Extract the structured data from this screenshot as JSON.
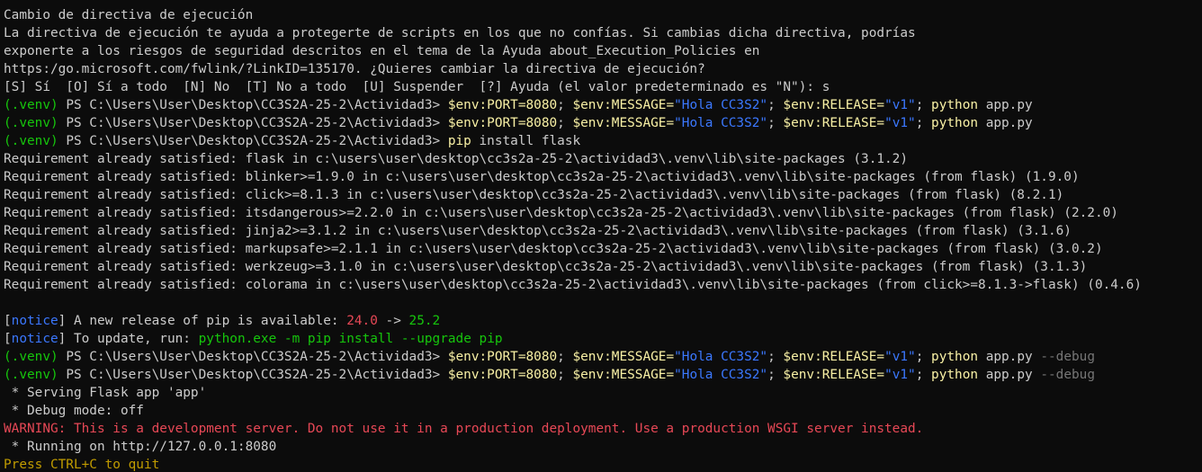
{
  "window": {
    "title": ""
  },
  "colors": {
    "default": "#cccccc",
    "venv": "#16c60c",
    "cmd": "#f9f1a5",
    "param": "#767676",
    "string": "#3b78ff",
    "notice_bracket": "#cccccc",
    "notice": "#3b78ff",
    "red": "#e74856",
    "green": "#16c60c",
    "yellow": "#c19c00"
  },
  "lines": [
    [
      {
        "t": "Cambio de directiva de ejecución",
        "c": "default"
      }
    ],
    [
      {
        "t": "La directiva de ejecución te ayuda a protegerte de scripts en los que no confías. Si cambias dicha directiva, podrías",
        "c": "default"
      }
    ],
    [
      {
        "t": "exponerte a los riesgos de seguridad descritos en el tema de la Ayuda about_Execution_Policies en",
        "c": "default"
      }
    ],
    [
      {
        "t": "https:/go.microsoft.com/fwlink/?LinkID=135170. ¿Quieres cambiar la directiva de ejecución?",
        "c": "default"
      }
    ],
    [
      {
        "t": "[S] Sí  [O] Sí a todo  [N] No  [T] No a todo  [U] Suspender  [?] Ayuda (el valor predeterminado es \"N\"): s",
        "c": "default"
      }
    ],
    [
      {
        "t": "(.venv)",
        "c": "venv"
      },
      {
        "t": " PS C:\\Users\\User\\Desktop\\CC3S2A-25-2\\Actividad3> ",
        "c": "default"
      },
      {
        "t": "$env:PORT=8080",
        "c": "cmd"
      },
      {
        "t": "; ",
        "c": "default"
      },
      {
        "t": "$env:MESSAGE=",
        "c": "cmd"
      },
      {
        "t": "\"Hola CC3S2\"",
        "c": "string"
      },
      {
        "t": "; ",
        "c": "default"
      },
      {
        "t": "$env:RELEASE=",
        "c": "cmd"
      },
      {
        "t": "\"v1\"",
        "c": "string"
      },
      {
        "t": "; ",
        "c": "default"
      },
      {
        "t": "python",
        "c": "cmd"
      },
      {
        "t": " app.py",
        "c": "default"
      }
    ],
    [
      {
        "t": "(.venv)",
        "c": "venv"
      },
      {
        "t": " PS C:\\Users\\User\\Desktop\\CC3S2A-25-2\\Actividad3> ",
        "c": "default"
      },
      {
        "t": "$env:PORT=8080",
        "c": "cmd"
      },
      {
        "t": "; ",
        "c": "default"
      },
      {
        "t": "$env:MESSAGE=",
        "c": "cmd"
      },
      {
        "t": "\"Hola CC3S2\"",
        "c": "string"
      },
      {
        "t": "; ",
        "c": "default"
      },
      {
        "t": "$env:RELEASE=",
        "c": "cmd"
      },
      {
        "t": "\"v1\"",
        "c": "string"
      },
      {
        "t": "; ",
        "c": "default"
      },
      {
        "t": "python",
        "c": "cmd"
      },
      {
        "t": " app.py",
        "c": "default"
      }
    ],
    [
      {
        "t": "(.venv)",
        "c": "venv"
      },
      {
        "t": " PS C:\\Users\\User\\Desktop\\CC3S2A-25-2\\Actividad3> ",
        "c": "default"
      },
      {
        "t": "pip",
        "c": "cmd"
      },
      {
        "t": " install flask",
        "c": "default"
      }
    ],
    [
      {
        "t": "Requirement already satisfied: flask in c:\\users\\user\\desktop\\cc3s2a-25-2\\actividad3\\.venv\\lib\\site-packages (3.1.2)",
        "c": "default"
      }
    ],
    [
      {
        "t": "Requirement already satisfied: blinker>=1.9.0 in c:\\users\\user\\desktop\\cc3s2a-25-2\\actividad3\\.venv\\lib\\site-packages (from flask) (1.9.0)",
        "c": "default"
      }
    ],
    [
      {
        "t": "Requirement already satisfied: click>=8.1.3 in c:\\users\\user\\desktop\\cc3s2a-25-2\\actividad3\\.venv\\lib\\site-packages (from flask) (8.2.1)",
        "c": "default"
      }
    ],
    [
      {
        "t": "Requirement already satisfied: itsdangerous>=2.2.0 in c:\\users\\user\\desktop\\cc3s2a-25-2\\actividad3\\.venv\\lib\\site-packages (from flask) (2.2.0)",
        "c": "default"
      }
    ],
    [
      {
        "t": "Requirement already satisfied: jinja2>=3.1.2 in c:\\users\\user\\desktop\\cc3s2a-25-2\\actividad3\\.venv\\lib\\site-packages (from flask) (3.1.6)",
        "c": "default"
      }
    ],
    [
      {
        "t": "Requirement already satisfied: markupsafe>=2.1.1 in c:\\users\\user\\desktop\\cc3s2a-25-2\\actividad3\\.venv\\lib\\site-packages (from flask) (3.0.2)",
        "c": "default"
      }
    ],
    [
      {
        "t": "Requirement already satisfied: werkzeug>=3.1.0 in c:\\users\\user\\desktop\\cc3s2a-25-2\\actividad3\\.venv\\lib\\site-packages (from flask) (3.1.3)",
        "c": "default"
      }
    ],
    [
      {
        "t": "Requirement already satisfied: colorama in c:\\users\\user\\desktop\\cc3s2a-25-2\\actividad3\\.venv\\lib\\site-packages (from click>=8.1.3->flask) (0.4.6)",
        "c": "default"
      }
    ],
    [],
    [
      {
        "t": "[",
        "c": "notice_bracket"
      },
      {
        "t": "notice",
        "c": "notice"
      },
      {
        "t": "]",
        "c": "notice_bracket"
      },
      {
        "t": " A new release of pip is available: ",
        "c": "default"
      },
      {
        "t": "24.0",
        "c": "red"
      },
      {
        "t": " -> ",
        "c": "default"
      },
      {
        "t": "25.2",
        "c": "green"
      }
    ],
    [
      {
        "t": "[",
        "c": "notice_bracket"
      },
      {
        "t": "notice",
        "c": "notice"
      },
      {
        "t": "]",
        "c": "notice_bracket"
      },
      {
        "t": " To update, run: ",
        "c": "default"
      },
      {
        "t": "python.exe -m pip install --upgrade pip",
        "c": "green"
      }
    ],
    [
      {
        "t": "(.venv)",
        "c": "venv"
      },
      {
        "t": " PS C:\\Users\\User\\Desktop\\CC3S2A-25-2\\Actividad3> ",
        "c": "default"
      },
      {
        "t": "$env:PORT=8080",
        "c": "cmd"
      },
      {
        "t": "; ",
        "c": "default"
      },
      {
        "t": "$env:MESSAGE=",
        "c": "cmd"
      },
      {
        "t": "\"Hola CC3S2\"",
        "c": "string"
      },
      {
        "t": "; ",
        "c": "default"
      },
      {
        "t": "$env:RELEASE=",
        "c": "cmd"
      },
      {
        "t": "\"v1\"",
        "c": "string"
      },
      {
        "t": "; ",
        "c": "default"
      },
      {
        "t": "python",
        "c": "cmd"
      },
      {
        "t": " app.py ",
        "c": "default"
      },
      {
        "t": "--debug",
        "c": "param"
      }
    ],
    [
      {
        "t": "(.venv)",
        "c": "venv"
      },
      {
        "t": " PS C:\\Users\\User\\Desktop\\CC3S2A-25-2\\Actividad3> ",
        "c": "default"
      },
      {
        "t": "$env:PORT=8080",
        "c": "cmd"
      },
      {
        "t": "; ",
        "c": "default"
      },
      {
        "t": "$env:MESSAGE=",
        "c": "cmd"
      },
      {
        "t": "\"Hola CC3S2\"",
        "c": "string"
      },
      {
        "t": "; ",
        "c": "default"
      },
      {
        "t": "$env:RELEASE=",
        "c": "cmd"
      },
      {
        "t": "\"v1\"",
        "c": "string"
      },
      {
        "t": "; ",
        "c": "default"
      },
      {
        "t": "python",
        "c": "cmd"
      },
      {
        "t": " app.py ",
        "c": "default"
      },
      {
        "t": "--debug",
        "c": "param"
      }
    ],
    [
      {
        "t": " * Serving Flask app 'app'",
        "c": "default"
      }
    ],
    [
      {
        "t": " * Debug mode: off",
        "c": "default"
      }
    ],
    [
      {
        "t": "WARNING: This is a development server. Do not use it in a production deployment. Use a production WSGI server instead.",
        "c": "red"
      }
    ],
    [
      {
        "t": " * Running on http://127.0.0.1:8080",
        "c": "default"
      }
    ],
    [
      {
        "t": "Press CTRL+C to quit",
        "c": "yellow"
      }
    ]
  ]
}
